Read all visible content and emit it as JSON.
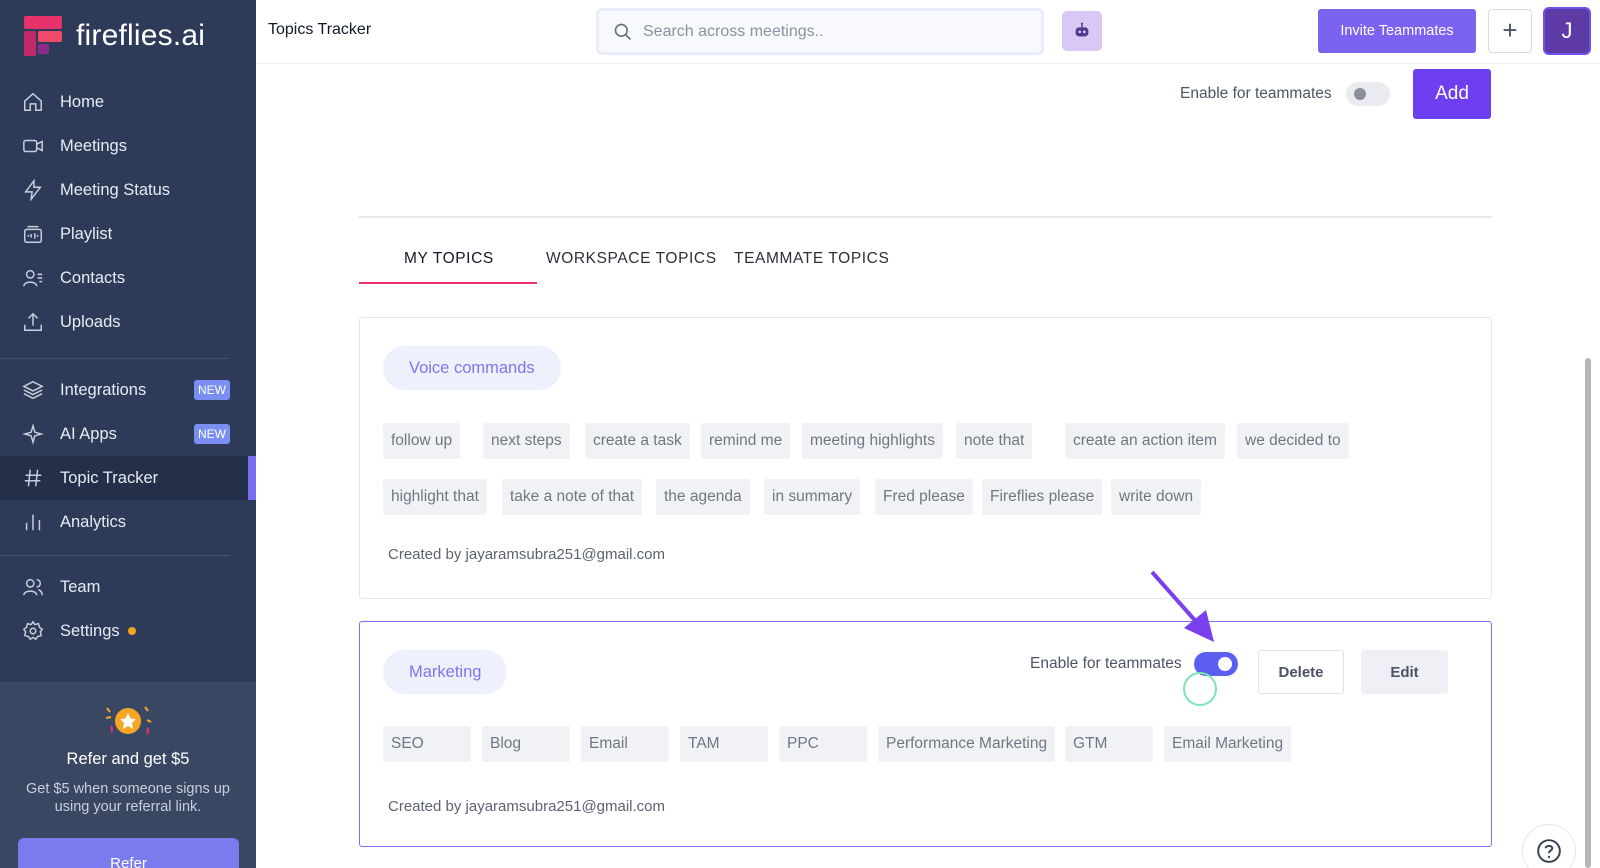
{
  "brand": {
    "name": "fireflies.ai"
  },
  "sidebar": {
    "items": [
      {
        "label": "Home",
        "icon": "home-icon"
      },
      {
        "label": "Meetings",
        "icon": "video-icon"
      },
      {
        "label": "Meeting Status",
        "icon": "bolt-icon"
      },
      {
        "label": "Playlist",
        "icon": "playlist-icon"
      },
      {
        "label": "Contacts",
        "icon": "contacts-icon"
      },
      {
        "label": "Uploads",
        "icon": "upload-icon"
      },
      {
        "label": "Integrations",
        "icon": "layers-icon",
        "badge": "NEW"
      },
      {
        "label": "AI Apps",
        "icon": "sparkle-icon",
        "badge": "NEW"
      },
      {
        "label": "Topic Tracker",
        "icon": "hash-icon",
        "active": true
      },
      {
        "label": "Analytics",
        "icon": "bar-chart-icon"
      },
      {
        "label": "Team",
        "icon": "team-icon"
      },
      {
        "label": "Settings",
        "icon": "gear-icon",
        "dot_color": "#f5a524"
      }
    ],
    "refer": {
      "title": "Refer and get $5",
      "description": "Get $5 when someone signs up using your referral link.",
      "button": "Refer"
    }
  },
  "topbar": {
    "title": "Topics Tracker",
    "search_placeholder": "Search across meetings..",
    "invite_label": "Invite Teammates",
    "plus_label": "+",
    "avatar_initial": "J"
  },
  "main": {
    "enable_label": "Enable for teammates",
    "add_label": "Add",
    "tabs": [
      "MY TOPICS",
      "WORKSPACE TOPICS",
      "TEAMMATE TOPICS"
    ],
    "topics": [
      {
        "name": "Voice commands",
        "keywords": [
          "follow up",
          "next steps",
          "create a task",
          "remind me",
          "meeting highlights",
          "note that",
          "create an action item",
          "we decided to",
          "highlight that",
          "take a note of that",
          "the agenda",
          "in summary",
          "Fred please",
          "Fireflies please",
          "write down"
        ],
        "created_by": "Created by jayaramsubra251@gmail.com"
      },
      {
        "name": "Marketing",
        "enable_label": "Enable for teammates",
        "enabled": true,
        "delete_label": "Delete",
        "edit_label": "Edit",
        "keywords": [
          "SEO",
          "Blog",
          "Email",
          "TAM",
          "PPC",
          "Performance Marketing",
          "GTM",
          "Email Marketing"
        ],
        "created_by": "Created by jayaramsubra251@gmail.com"
      }
    ]
  },
  "colors": {
    "sidebar_bg": "#2e3b58",
    "accent": "#6d3ff0",
    "tab_underline": "#e8336a",
    "toggle_on": "#5b5ef0"
  }
}
